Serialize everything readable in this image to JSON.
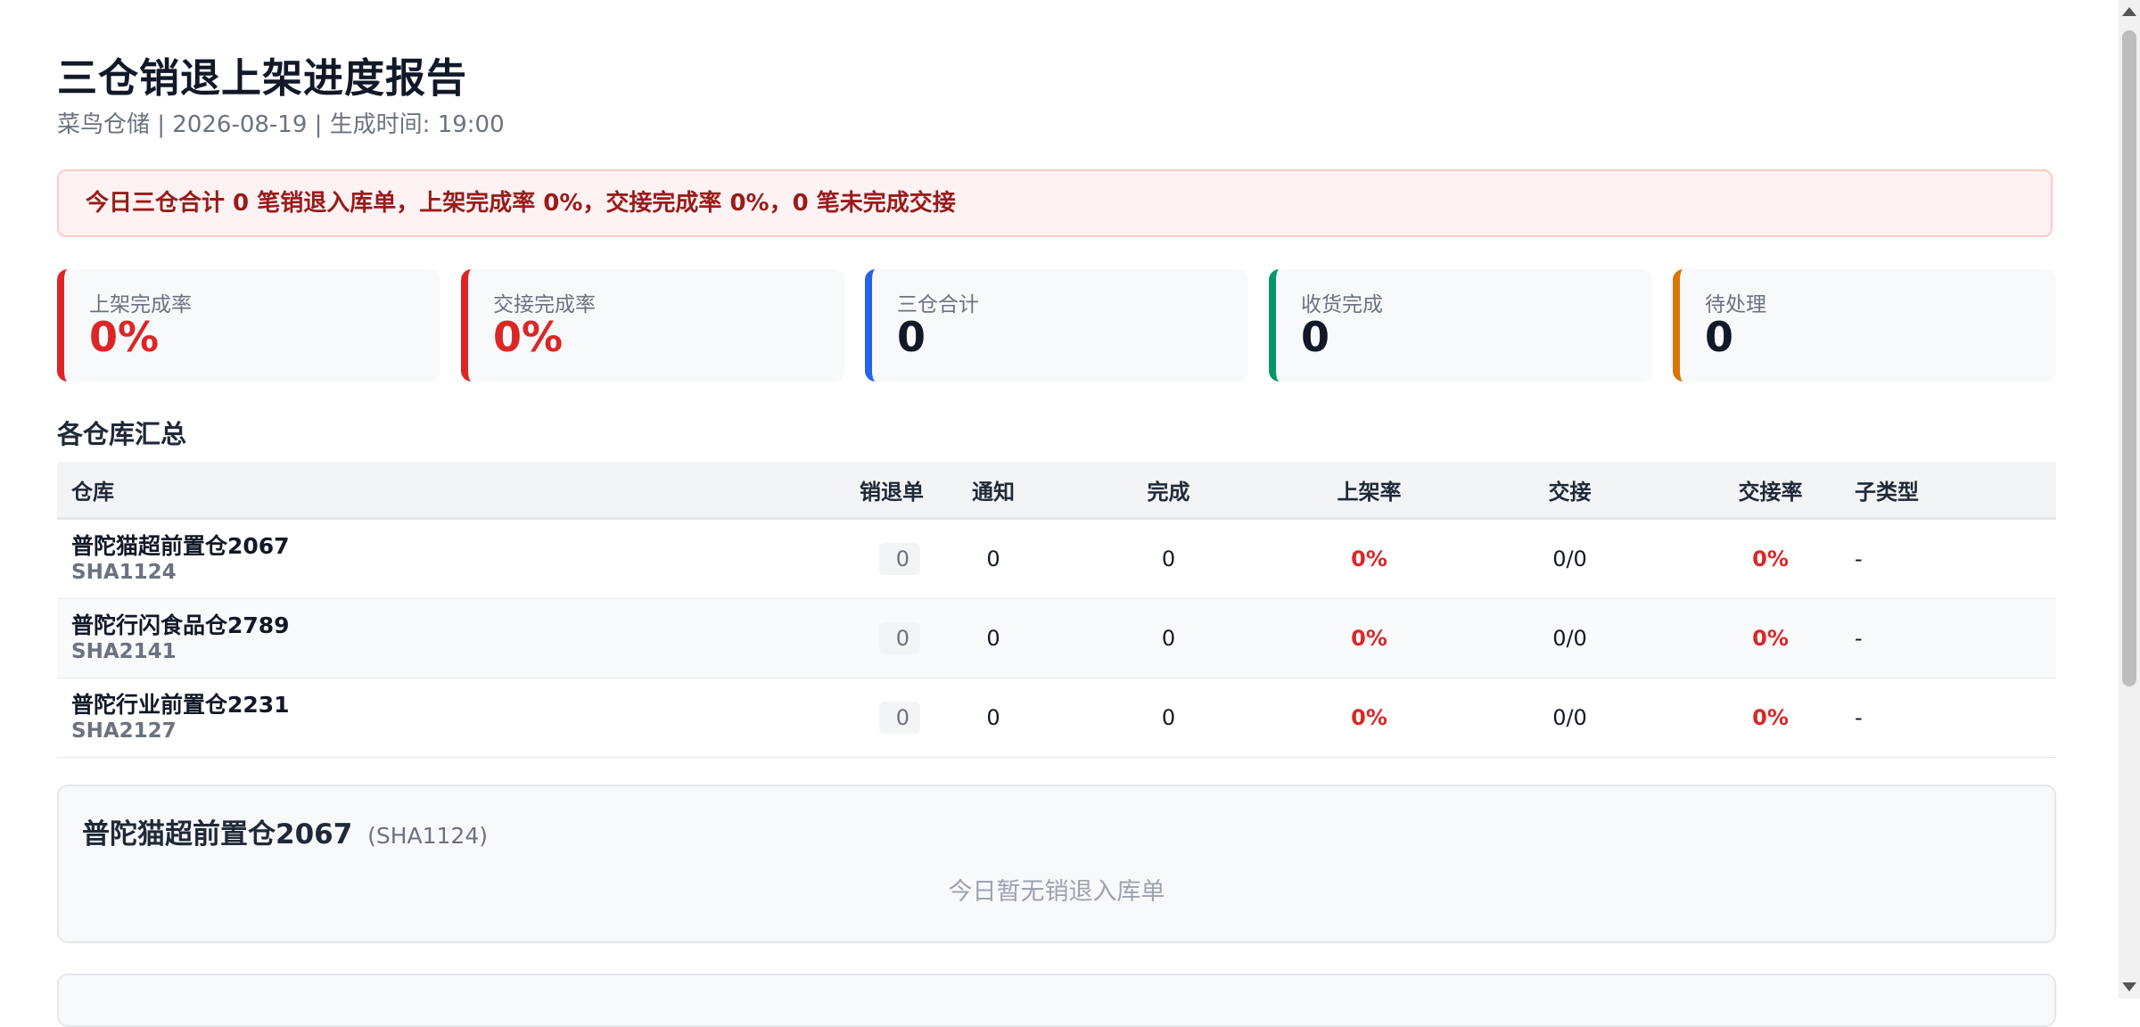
{
  "header": {
    "title": "三仓销退上架进度报告",
    "subtitle": "菜鸟仓储 | 2026-08-19 | 生成时间: 19:00"
  },
  "alert": {
    "text": "今日三仓合计 0 笔销退入库单，上架完成率 0%，交接完成率 0%，0 笔未完成交接"
  },
  "cards": [
    {
      "label": "上架完成率",
      "value": "0%",
      "color": "#dc2626"
    },
    {
      "label": "交接完成率",
      "value": "0%",
      "color": "#dc2626"
    },
    {
      "label": "三仓合计",
      "value": "0",
      "color": "#2563eb"
    },
    {
      "label": "收货完成",
      "value": "0",
      "color": "#059669"
    },
    {
      "label": "待处理",
      "value": "0",
      "color": "#d97706"
    }
  ],
  "summary": {
    "title": "各仓库汇总",
    "columns": [
      "仓库",
      "销退单",
      "通知",
      "完成",
      "上架率",
      "交接",
      "交接率",
      "子类型"
    ],
    "rows": [
      {
        "name": "普陀猫超前置仓2067",
        "code": "SHA1124",
        "orders": "0",
        "notified": "0",
        "done": "0",
        "shelf_rate": "0%",
        "handover": "0/0",
        "handover_rate": "0%",
        "subtype": "-"
      },
      {
        "name": "普陀行闪食品仓2789",
        "code": "SHA2141",
        "orders": "0",
        "notified": "0",
        "done": "0",
        "shelf_rate": "0%",
        "handover": "0/0",
        "handover_rate": "0%",
        "subtype": "-"
      },
      {
        "name": "普陀行业前置仓2231",
        "code": "SHA2127",
        "orders": "0",
        "notified": "0",
        "done": "0",
        "shelf_rate": "0%",
        "handover": "0/0",
        "handover_rate": "0%",
        "subtype": "-"
      }
    ]
  },
  "details": [
    {
      "name": "普陀猫超前置仓2067",
      "code": "(SHA1124)",
      "empty": "今日暂无销退入库单"
    }
  ]
}
